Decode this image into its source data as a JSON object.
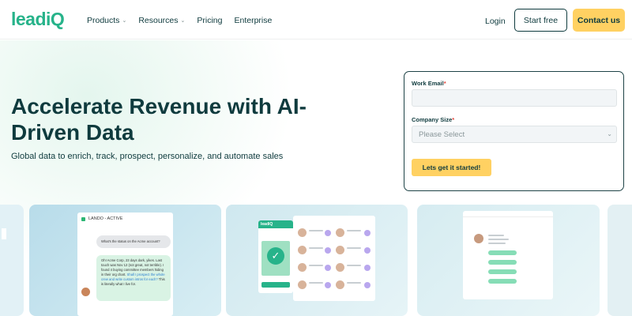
{
  "nav": {
    "logo": "leadiQ",
    "links": [
      {
        "label": "Products",
        "has_dropdown": true
      },
      {
        "label": "Resources",
        "has_dropdown": true
      },
      {
        "label": "Pricing",
        "has_dropdown": false
      },
      {
        "label": "Enterprise",
        "has_dropdown": false
      }
    ],
    "login": "Login",
    "start_free": "Start free",
    "contact_us": "Contact us"
  },
  "hero": {
    "headline": "Accelerate Revenue with AI-Driven Data",
    "subheadline": "Global data to enrich, track, prospect, personalize, and automate sales"
  },
  "form": {
    "email_label": "Work Email",
    "email_required": "*",
    "email_value": "",
    "company_size_label": "Company Size",
    "company_size_required": "*",
    "company_size_placeholder": "Please Select",
    "submit_label": "Lets get it started!"
  },
  "cards": {
    "chat": {
      "header": "LANDO - ACTIVE",
      "user_message": "What's the status on the Acme account?",
      "reply": "Oh! Acme Corp, 23 days dark, yikes. Last touch was Nov 12 (not great, not terrible). I found 4 buying committee members hiding in their org chart.",
      "reply_link": "Shall I prospect the whole crew and write custom intros for each?",
      "reply_tail": "This is literally what I live for."
    },
    "dashboard": {
      "logo": "leadiQ"
    }
  },
  "colors": {
    "brand_green": "#27b38a",
    "navy": "#0f3b3e",
    "accent_yellow": "#ffd162"
  }
}
